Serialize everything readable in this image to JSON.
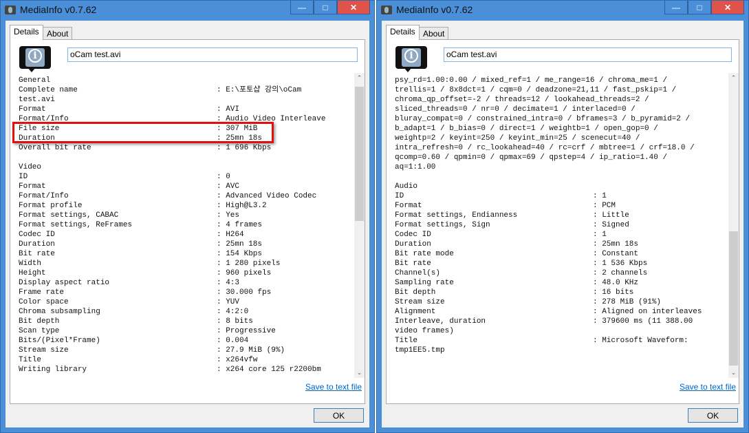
{
  "windows": [
    {
      "title": "MediaInfo v0.7.62",
      "tabs": [
        "Details",
        "About"
      ],
      "filename": "oCam test.avi",
      "save_label": "Save to text file",
      "ok_label": "OK",
      "lines": [
        [
          "General"
        ],
        [
          "Complete name",
          "E:\\포토샵 강의\\oCam"
        ],
        [
          "test.avi"
        ],
        [
          "Format",
          "AVI"
        ],
        [
          "Format/Info",
          "Audio Video Interleave"
        ],
        [
          "File size",
          "307 MiB"
        ],
        [
          "Duration",
          "25mn 18s"
        ],
        [
          "Overall bit rate",
          "1 696 Kbps"
        ],
        [
          ""
        ],
        [
          "Video"
        ],
        [
          "ID",
          "0"
        ],
        [
          "Format",
          "AVC"
        ],
        [
          "Format/Info",
          "Advanced Video Codec"
        ],
        [
          "Format profile",
          "High@L3.2"
        ],
        [
          "Format settings, CABAC",
          "Yes"
        ],
        [
          "Format settings, ReFrames",
          "4 frames"
        ],
        [
          "Codec ID",
          "H264"
        ],
        [
          "Duration",
          "25mn 18s"
        ],
        [
          "Bit rate",
          "154 Kbps"
        ],
        [
          "Width",
          "1 280 pixels"
        ],
        [
          "Height",
          "960 pixels"
        ],
        [
          "Display aspect ratio",
          "4:3"
        ],
        [
          "Frame rate",
          "30.000 fps"
        ],
        [
          "Color space",
          "YUV"
        ],
        [
          "Chroma subsampling",
          "4:2:0"
        ],
        [
          "Bit depth",
          "8 bits"
        ],
        [
          "Scan type",
          "Progressive"
        ],
        [
          "Bits/(Pixel*Frame)",
          "0.004"
        ],
        [
          "Stream size",
          "27.9 MiB (9%)"
        ],
        [
          "Title",
          "x264vfw"
        ],
        [
          "Writing library",
          "x264 core 125 r2200bm"
        ]
      ],
      "scroll_position": 0.0
    },
    {
      "title": "MediaInfo v0.7.62",
      "tabs": [
        "Details",
        "About"
      ],
      "filename": "oCam test.avi",
      "save_label": "Save to text file",
      "ok_label": "OK",
      "lines": [
        [
          "psy_rd=1.00:0.00 / mixed_ref=1 / me_range=16 / chroma_me=1 /"
        ],
        [
          "trellis=1 / 8x8dct=1 / cqm=0 / deadzone=21,11 / fast_pskip=1 /"
        ],
        [
          "chroma_qp_offset=-2 / threads=12 / lookahead_threads=2 /"
        ],
        [
          "sliced_threads=0 / nr=0 / decimate=1 / interlaced=0 /"
        ],
        [
          "bluray_compat=0 / constrained_intra=0 / bframes=3 / b_pyramid=2 /"
        ],
        [
          "b_adapt=1 / b_bias=0 / direct=1 / weightb=1 / open_gop=0 /"
        ],
        [
          "weightp=2 / keyint=250 / keyint_min=25 / scenecut=40 /"
        ],
        [
          "intra_refresh=0 / rc_lookahead=40 / rc=crf / mbtree=1 / crf=18.0 /"
        ],
        [
          "qcomp=0.60 / qpmin=0 / qpmax=69 / qpstep=4 / ip_ratio=1.40 /"
        ],
        [
          "aq=1:1.00"
        ],
        [
          ""
        ],
        [
          "Audio"
        ],
        [
          "ID",
          "1"
        ],
        [
          "Format",
          "PCM"
        ],
        [
          "Format settings, Endianness",
          "Little"
        ],
        [
          "Format settings, Sign",
          "Signed"
        ],
        [
          "Codec ID",
          "1"
        ],
        [
          "Duration",
          "25mn 18s"
        ],
        [
          "Bit rate mode",
          "Constant"
        ],
        [
          "Bit rate",
          "1 536 Kbps"
        ],
        [
          "Channel(s)",
          "2 channels"
        ],
        [
          "Sampling rate",
          "48.0 KHz"
        ],
        [
          "Bit depth",
          "16 bits"
        ],
        [
          "Stream size",
          "278 MiB (91%)"
        ],
        [
          "Alignment",
          "Aligned on interleaves"
        ],
        [
          "Interleave, duration",
          "379600 ms (11 388.00"
        ],
        [
          "video frames)"
        ],
        [
          "Title",
          "Microsoft Waveform:"
        ],
        [
          "tmp1EE5.tmp"
        ]
      ],
      "scroll_position": 1.0
    }
  ],
  "highlight_color": "#e01010"
}
